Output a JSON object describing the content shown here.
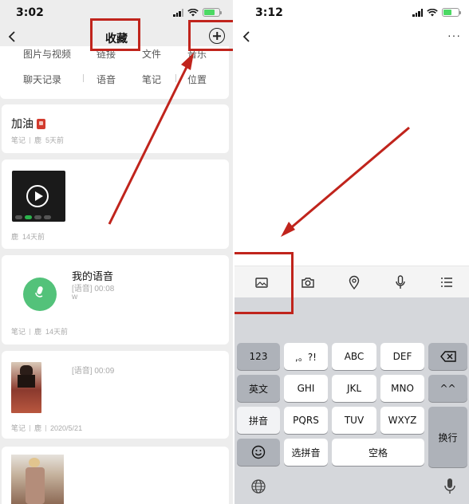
{
  "left_phone": {
    "status_time": "3:02",
    "title": "收藏",
    "categories_row1": [
      "图片与视频",
      "链接",
      "文件",
      "音乐"
    ],
    "categories_row2": [
      "聊天记录",
      "语音",
      "笔记",
      "位置"
    ],
    "items": [
      {
        "title": "加油",
        "meta_type": "笔记",
        "meta_source": "鹿",
        "meta_time": "5天前"
      },
      {
        "meta_source": "鹿",
        "meta_time": "14天前"
      },
      {
        "title": "我的语音",
        "subtitle": "[语音] 00:08",
        "extra": "w",
        "meta_type": "笔记",
        "meta_source": "鹿",
        "meta_time": "14天前"
      },
      {
        "subtitle": "[语音] 00:09",
        "meta_type": "笔记",
        "meta_source": "鹿",
        "meta_time": "2020/5/21"
      }
    ]
  },
  "right_phone": {
    "status_time": "3:12",
    "more": "···",
    "toolbar_icons": [
      "image-icon",
      "camera-icon",
      "location-icon",
      "microphone-icon",
      "list-icon"
    ],
    "keys": {
      "row1": [
        "123",
        ",。?!",
        "ABC",
        "DEF"
      ],
      "row2": [
        "英文",
        "GHI",
        "JKL",
        "MNO",
        "^^"
      ],
      "row3": [
        "拼音",
        "PQRS",
        "TUV",
        "WXYZ"
      ],
      "enter": "换行",
      "pinyin_select": "选拼音",
      "space": "空格"
    }
  },
  "colors": {
    "highlight": "#c0241c",
    "voice_green": "#53c27a",
    "battery_green": "#4cd964"
  }
}
